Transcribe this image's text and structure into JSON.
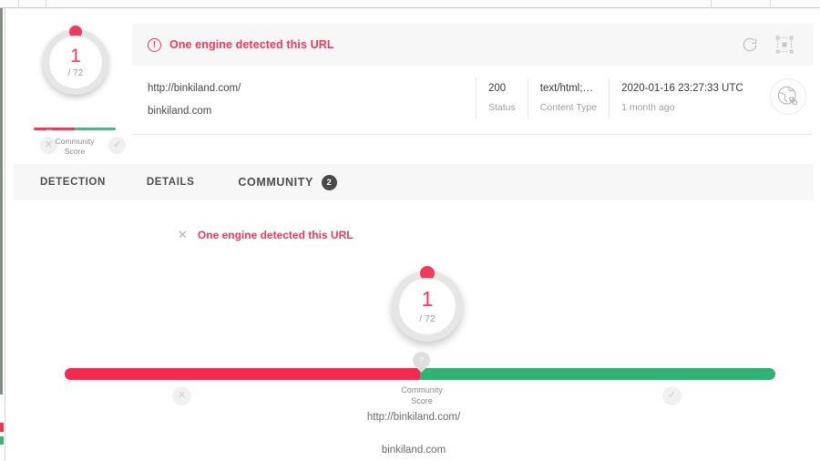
{
  "browser_chrome": {
    "present": true
  },
  "summary": {
    "gauge": {
      "detections": "1",
      "total": "/ 72",
      "marker_icon": "red-dot"
    },
    "community_slider": {
      "marker_icon": "x-teardrop-marker",
      "marker_glyph": "✕",
      "left_icon": "✕",
      "right_icon": "✓",
      "label_line1": "Community",
      "label_line2": "Score",
      "red_color": "#f3395c",
      "green_color": "#4cb784"
    },
    "alert": {
      "icon": "exclamation-circle-icon",
      "icon_glyph": "!",
      "message": "One engine detected this URL",
      "color": "#f3395c"
    },
    "actions": [
      {
        "name": "reload-icon",
        "label": "Reload"
      },
      {
        "name": "focus-icon",
        "label": "Focus"
      }
    ],
    "url": {
      "full": "http://binkiland.com/",
      "domain": "binkiland.com"
    },
    "meta": [
      {
        "value": "200",
        "label": "Status"
      },
      {
        "value": "text/html;…",
        "label": "Content Type"
      },
      {
        "value": "2020-01-16 23:27:33 UTC",
        "label": "1 month ago"
      }
    ],
    "type_icon": "globe-link-icon"
  },
  "tabs": [
    {
      "label": "DETECTION",
      "active": true
    },
    {
      "label": "DETAILS",
      "active": false
    },
    {
      "label": "COMMUNITY",
      "active": false,
      "badge": "2"
    }
  ],
  "detection": {
    "status_icon": "✕",
    "message": "One engine detected this URL",
    "gauge": {
      "detections": "1",
      "total": "/ 72",
      "marker_icon": "red-dot"
    },
    "community_slider": {
      "marker_glyph": "?",
      "left_icon": "✕",
      "right_icon": "✓",
      "label_line1": "Community",
      "label_line2": "Score",
      "red_color": "#f7294e",
      "green_color": "#2fb474",
      "red_fraction": 50
    },
    "url_full": "http://binkiland.com/",
    "url_domain": "binkiland.com"
  }
}
